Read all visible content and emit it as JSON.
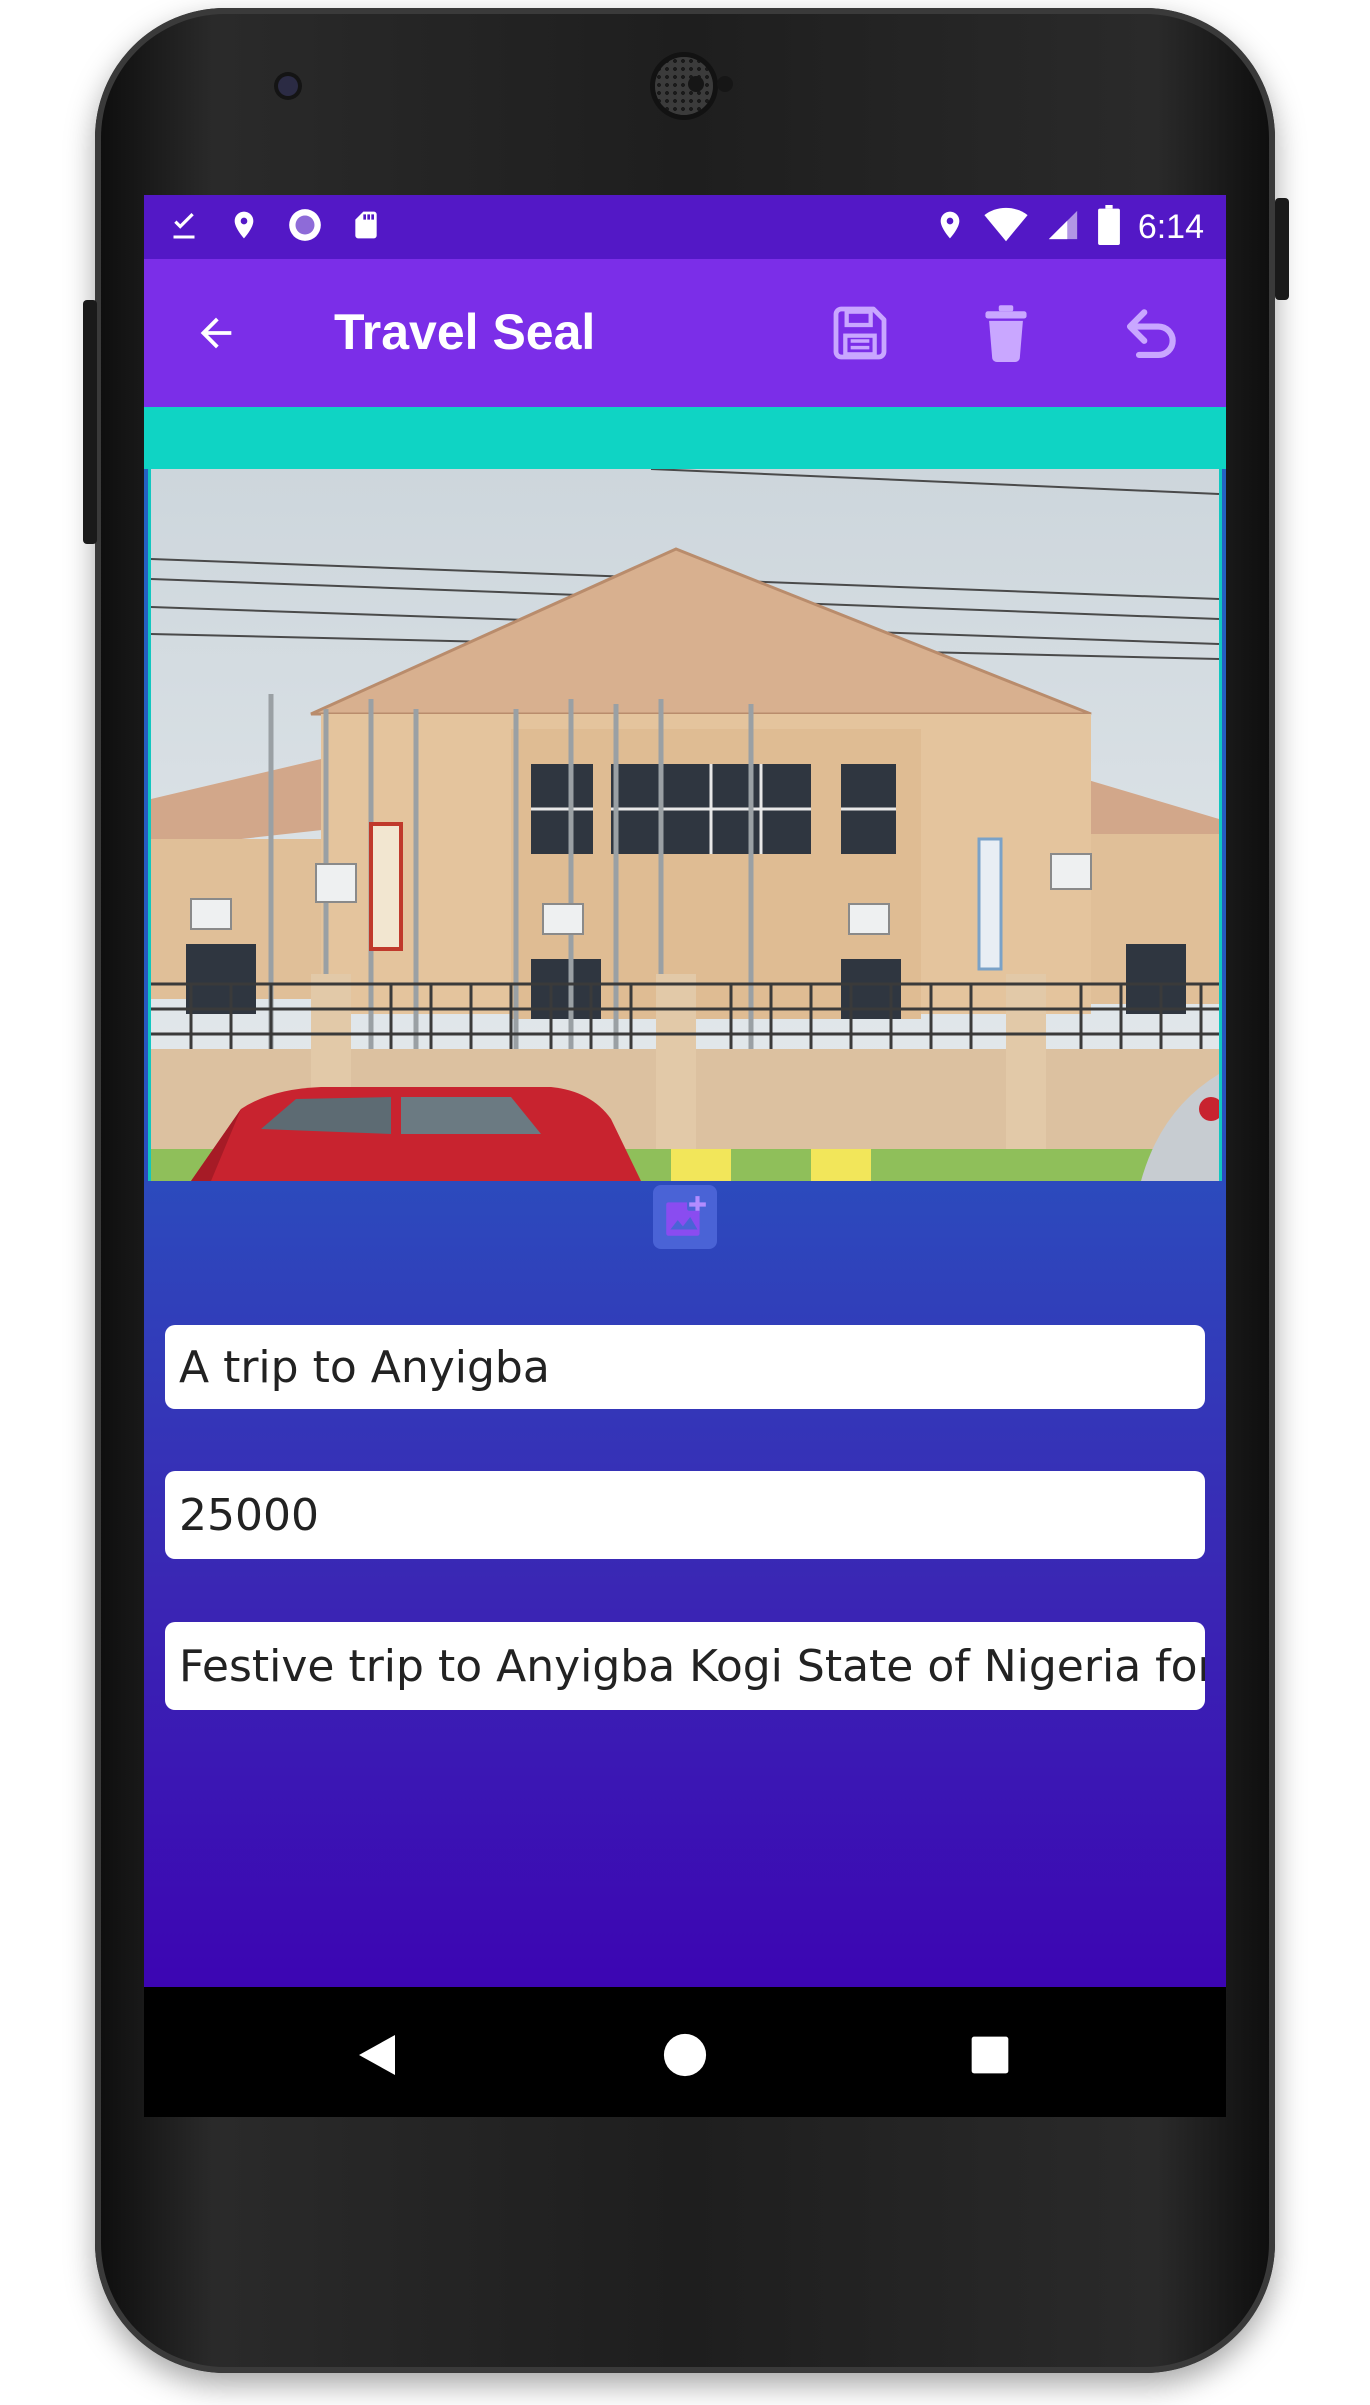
{
  "status_bar": {
    "time": "6:14",
    "left_icons": [
      "download-done-icon",
      "location-icon",
      "sync-circle-icon",
      "sd-card-icon"
    ],
    "right_icons": [
      "location-icon",
      "wifi-icon",
      "signal-icon",
      "battery-icon"
    ]
  },
  "app_bar": {
    "title": "Travel Seal",
    "actions": [
      "save-icon",
      "delete-icon",
      "undo-icon"
    ]
  },
  "form": {
    "title_value": "A trip to Anyigba",
    "amount_value": "25000",
    "description_value": "Festive trip to Anyigba Kogi State of Nigeria for th"
  },
  "colors": {
    "status_bar": "#5318c6",
    "app_bar": "#7b2ee8",
    "accent_teal": "#0fd4c4",
    "gradient_top": "#2463c2",
    "gradient_bottom": "#3c05b3",
    "icon_lilac": "#c9a7ff"
  },
  "nav": {
    "buttons": [
      "back-triangle-icon",
      "home-circle-icon",
      "recents-square-icon"
    ]
  }
}
